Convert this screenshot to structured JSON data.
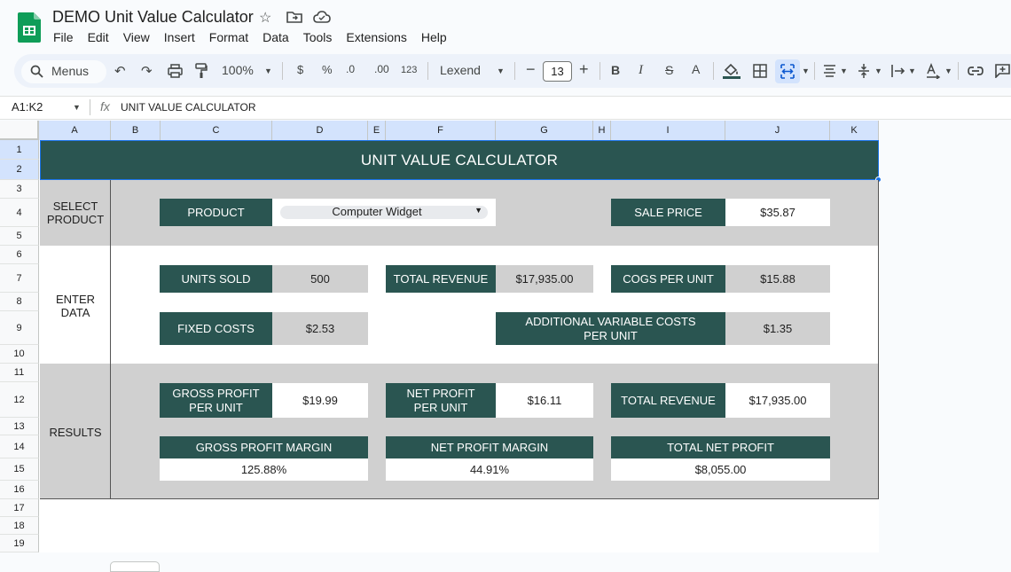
{
  "app": {
    "title": "DEMO Unit Value Calculator",
    "menu": [
      "File",
      "Edit",
      "View",
      "Insert",
      "Format",
      "Data",
      "Tools",
      "Extensions",
      "Help"
    ]
  },
  "toolbar": {
    "search_label": "Menus",
    "zoom": "100%",
    "currency": "$",
    "percent": "%",
    "dec_decrease": ".0",
    "dec_increase": ".00",
    "number_format": "123",
    "font": "Lexend",
    "font_size": "13",
    "bold": "B",
    "italic": "I",
    "strike": "S",
    "text_color": "A"
  },
  "formula_bar": {
    "range": "A1:K2",
    "fx": "fx",
    "value": "UNIT VALUE CALCULATOR"
  },
  "columns": [
    "A",
    "B",
    "C",
    "D",
    "E",
    "F",
    "G",
    "H",
    "I",
    "J",
    "K"
  ],
  "rows": [
    "1",
    "2",
    "3",
    "4",
    "5",
    "6",
    "7",
    "8",
    "9",
    "10",
    "11",
    "12",
    "13",
    "14",
    "15",
    "16",
    "17",
    "18",
    "19"
  ],
  "sheet": {
    "title": "UNIT VALUE CALCULATOR",
    "select_section": "SELECT PRODUCT",
    "enter_section": "ENTER DATA",
    "results_section": "RESULTS",
    "product_label": "PRODUCT",
    "product_value": "Computer Widget",
    "sale_price_label": "SALE PRICE",
    "sale_price_value": "$35.87",
    "units_sold_label": "UNITS SOLD",
    "units_sold_value": "500",
    "total_revenue_label": "TOTAL REVENUE",
    "total_revenue_value": "$17,935.00",
    "cogs_label": "COGS PER UNIT",
    "cogs_value": "$15.88",
    "fixed_costs_label": "FIXED COSTS",
    "fixed_costs_value": "$2.53",
    "add_var_label": "ADDITIONAL VARIABLE COSTS PER UNIT",
    "add_var_value": "$1.35",
    "gross_profit_unit_label": "GROSS PROFIT PER UNIT",
    "gross_profit_unit_value": "$19.99",
    "net_profit_unit_label": "NET PROFIT PER UNIT",
    "net_profit_unit_value": "$16.11",
    "result_total_revenue_label": "TOTAL REVENUE",
    "result_total_revenue_value": "$17,935.00",
    "gross_margin_label": "GROSS PROFIT MARGIN",
    "gross_margin_value": "125.88%",
    "net_margin_label": "NET PROFIT MARGIN",
    "net_margin_value": "44.91%",
    "total_net_profit_label": "TOTAL NET PROFIT",
    "total_net_profit_value": "$8,055.00"
  }
}
